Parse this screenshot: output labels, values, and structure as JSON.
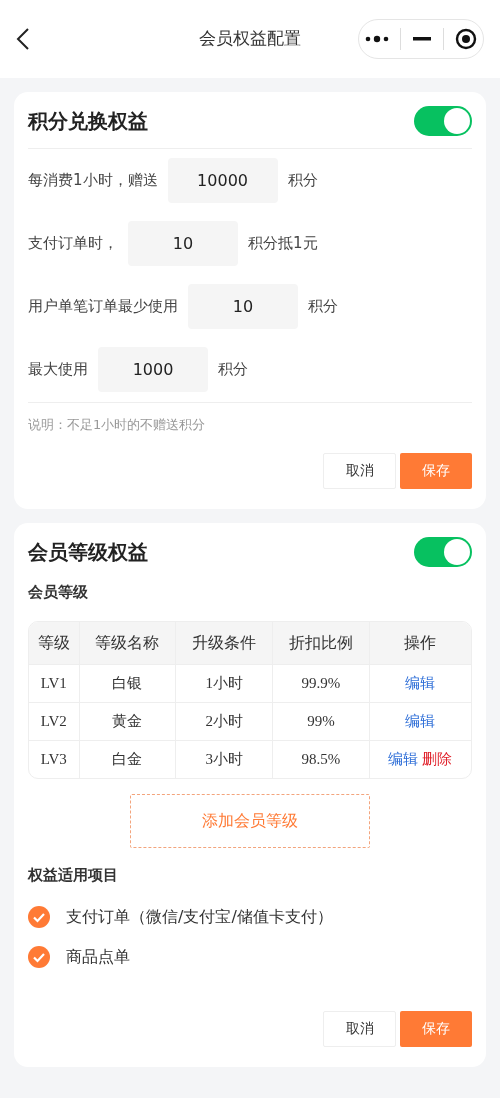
{
  "header": {
    "title": "会员权益配置"
  },
  "points_section": {
    "title": "积分兑换权益",
    "enabled": true,
    "rows": [
      {
        "prefix": "每消费1小时，赠送",
        "value": "10000",
        "suffix": "积分"
      },
      {
        "prefix": "支付订单时，",
        "value": "10",
        "suffix": "积分抵1元"
      },
      {
        "prefix": "用户单笔订单最少使用",
        "value": "10",
        "suffix": "积分"
      },
      {
        "prefix": "最大使用",
        "value": "1000",
        "suffix": "积分"
      }
    ],
    "note": "说明：不足1小时的不赠送积分",
    "buttons": [
      "取消",
      "保存"
    ]
  },
  "level_section": {
    "title": "会员等级权益",
    "enabled": true,
    "subtitle": "会员等级",
    "table": {
      "columns": [
        "等级",
        "等级名称",
        "升级条件",
        "折扣比例",
        "操作"
      ],
      "rows": [
        {
          "cells": [
            "LV1",
            "白银",
            "1小时",
            "99.9%"
          ],
          "actions": [
            {
              "label": "编辑",
              "kind": "edit"
            }
          ]
        },
        {
          "cells": [
            "LV2",
            "黄金",
            "2小时",
            "99%"
          ],
          "actions": [
            {
              "label": "编辑",
              "kind": "edit"
            }
          ]
        },
        {
          "cells": [
            "LV3",
            "白金",
            "3小时",
            "98.5%"
          ],
          "actions": [
            {
              "label": "编辑",
              "kind": "edit"
            },
            {
              "label": "删除",
              "kind": "delete"
            }
          ]
        }
      ]
    },
    "add_button": "添加会员等级",
    "scope_title": "权益适用项目",
    "scope_items": [
      {
        "label": "支付订单（微信/支付宝/储值卡支付）",
        "checked": true
      },
      {
        "label": "商品点单",
        "checked": true
      }
    ],
    "buttons": [
      "取消",
      "保存"
    ]
  }
}
